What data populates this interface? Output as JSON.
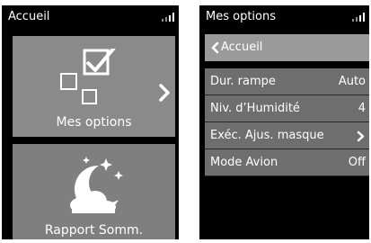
{
  "left_screen": {
    "title": "Accueil",
    "tiles": [
      {
        "label": "Mes options",
        "icon": "options-checkbox-icon"
      },
      {
        "label": "Rapport Somm.",
        "icon": "moon-stars-cloud-icon"
      }
    ]
  },
  "right_screen": {
    "title": "Mes options",
    "back_label": "Accueil",
    "rows": [
      {
        "label": "Dur. rampe",
        "value": "Auto"
      },
      {
        "label": "Niv. d’Humidité",
        "value": "4"
      },
      {
        "label": "Exéc. Ajus. masque",
        "value": ""
      },
      {
        "label": "Mode Avion",
        "value": "Off"
      }
    ]
  },
  "colors": {
    "screen_bg": "#000000",
    "tile_bg": "#8a8a8a",
    "row_bg": "#6e6e6e",
    "back_row_bg": "#9a9a9a",
    "text": "#ffffff"
  }
}
